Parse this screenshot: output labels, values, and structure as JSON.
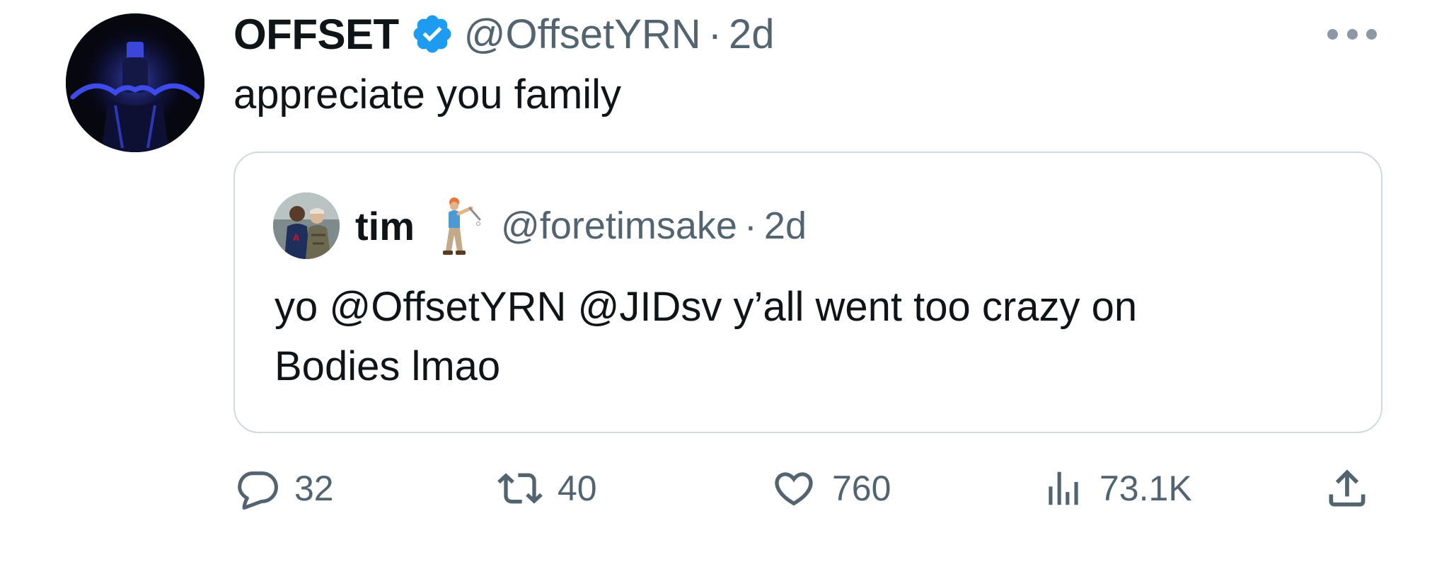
{
  "tweet": {
    "author": {
      "display_name": "OFFSET",
      "handle": "@OffsetYRN",
      "verified": true,
      "avatar_icon": "avatar-offset"
    },
    "separator": "·",
    "time": "2d",
    "text": "appreciate you family",
    "more_icon": "ellipsis-icon"
  },
  "quote": {
    "author": {
      "display_name": "tim",
      "emoji": "golfer-emoji",
      "handle": "@foretimsake",
      "avatar_icon": "avatar-tim"
    },
    "separator": "·",
    "time": "2d",
    "text_lines": [
      "yo @OffsetYRN @JIDsv y’all went too crazy on",
      "Bodies lmao"
    ]
  },
  "actions": {
    "reply": {
      "icon": "reply-icon",
      "count": "32"
    },
    "retweet": {
      "icon": "retweet-icon",
      "count": "40"
    },
    "like": {
      "icon": "heart-icon",
      "count": "760"
    },
    "views": {
      "icon": "views-icon",
      "count": "73.1K"
    },
    "share": {
      "icon": "share-icon"
    }
  },
  "colors": {
    "text_primary": "#0f1419",
    "text_secondary": "#536471",
    "verified_blue": "#1d9bf0",
    "border": "#cfd9de"
  }
}
